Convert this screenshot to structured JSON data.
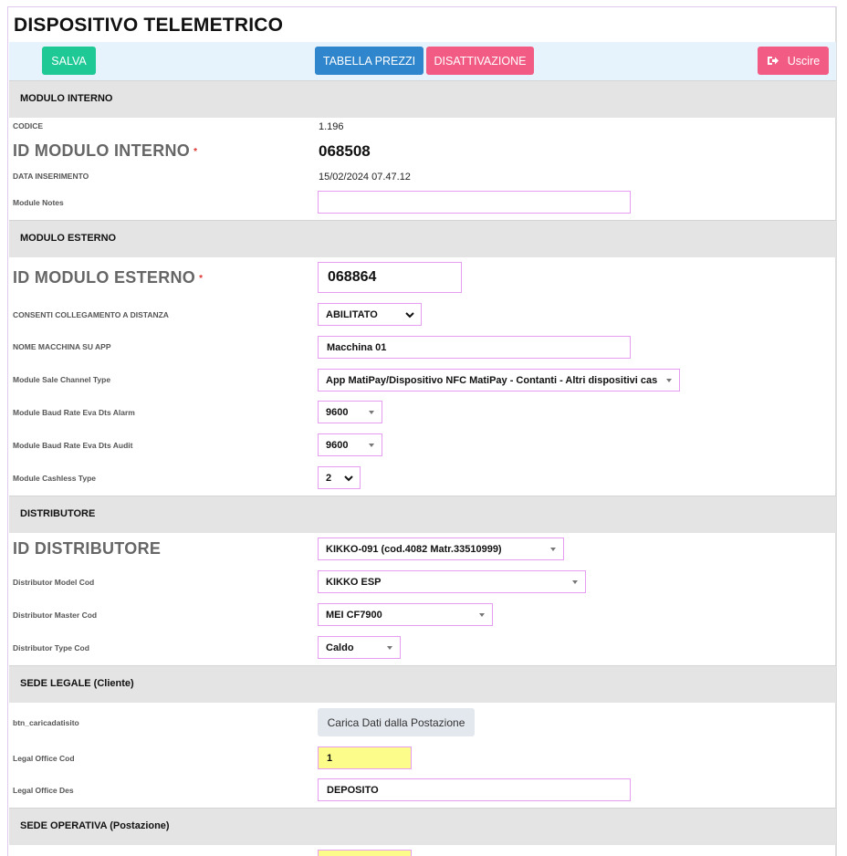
{
  "page": {
    "title": "DISPOSITIVO TELEMETRICO"
  },
  "toolbar": {
    "salva": "SALVA",
    "tabella_prezzi": "TABELLA PREZZI",
    "disattivazione": "DISATTIVAZIONE",
    "uscire": "Uscire",
    "uscire_icon": "sign-out-icon"
  },
  "colors": {
    "salva": "#1fc996",
    "tabella": "#2f86cc",
    "danger": "#f25c84",
    "toolbar_bg": "#e6f3fc",
    "section_bg": "#e4e4e4",
    "field_border": "#e69cf0",
    "highlight": "#fcfc8a"
  },
  "modulo_interno": {
    "header": "MODULO INTERNO",
    "codice_label": "CODICE",
    "codice_value": "1.196",
    "id_label": "ID MODULO INTERNO",
    "id_required": "*",
    "id_value": "068508",
    "data_label": "DATA INSERIMENTO",
    "data_value": "15/02/2024 07.47.12",
    "notes_label": "Module Notes",
    "notes_value": ""
  },
  "modulo_esterno": {
    "header": "MODULO ESTERNO",
    "id_label": "ID MODULO ESTERNO",
    "id_required": "*",
    "id_value": "068864",
    "collegamento_label": "CONSENTI COLLEGAMENTO A DISTANZA",
    "collegamento_value": "ABILITATO",
    "nome_label": "NOME MACCHINA SU APP",
    "nome_value": "Macchina 01",
    "sale_channel_label": "Module Sale Channel Type",
    "sale_channel_value": "App MatiPay/Dispositivo NFC MatiPay - Contanti - Altri dispositivi cas",
    "baud_alarm_label": "Module Baud Rate Eva Dts Alarm",
    "baud_alarm_value": "9600",
    "baud_audit_label": "Module Baud Rate Eva Dts Audit",
    "baud_audit_value": "9600",
    "cashless_label": "Module Cashless Type",
    "cashless_value": "2"
  },
  "distributore": {
    "header": "DISTRIBUTORE",
    "id_label": "ID DISTRIBUTORE",
    "id_value": "KIKKO-091 (cod.4082 Matr.33510999)",
    "model_label": "Distributor Model Cod",
    "model_value": "KIKKO ESP",
    "master_label": "Distributor Master Cod",
    "master_value": "MEI CF7900",
    "type_label": "Distributor Type Cod",
    "type_value": "Caldo"
  },
  "sede_legale": {
    "header": "SEDE LEGALE (Cliente)",
    "btn_label": "btn_caricadatisito",
    "btn_text": "Carica Dati dalla Postazione",
    "office_cod_label": "Legal Office Cod",
    "office_cod_value": "1",
    "office_des_label": "Legal Office Des",
    "office_des_value": "DEPOSITO"
  },
  "sede_operativa": {
    "header": "SEDE OPERATIVA (Postazione)"
  }
}
